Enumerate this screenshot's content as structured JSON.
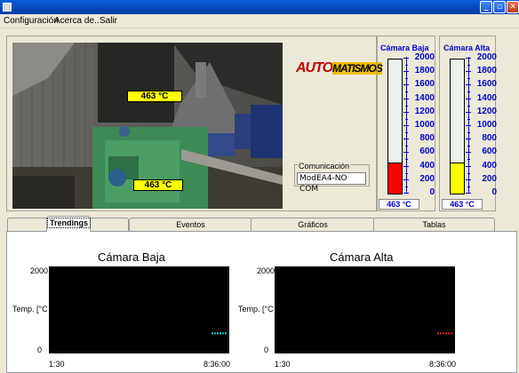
{
  "menu": {
    "items": [
      "Configuración",
      "Acerca de..",
      "Salir"
    ]
  },
  "photo": {
    "label_top": "463 °C",
    "label_bottom": "463 °C"
  },
  "logo": {
    "text_a": "AUTO",
    "text_b": "MATISMOS"
  },
  "comm": {
    "title": "Comunicación",
    "value": "ModEA4-NO COM"
  },
  "gauges": [
    {
      "title": "Cámara Baja",
      "value_text": "463 °C",
      "level": 463,
      "max": 2000,
      "color": "#ff0000",
      "ticks": [
        "2000",
        "1800",
        "1600",
        "1400",
        "1200",
        "1000",
        "800",
        "600",
        "400",
        "200",
        "0"
      ]
    },
    {
      "title": "Cámara Alta",
      "value_text": "463 °C",
      "level": 463,
      "max": 2000,
      "color": "#ffff00",
      "ticks": [
        "2000",
        "1800",
        "1600",
        "1400",
        "1200",
        "1000",
        "800",
        "600",
        "400",
        "200",
        "0"
      ]
    }
  ],
  "tabs": [
    "Trendings",
    "Eventos",
    "Gráficos",
    "Tablas"
  ],
  "active_tab": "Trendings",
  "chart_data": [
    {
      "type": "line",
      "title": "Cámara Baja",
      "ylabel": "Temp. [°C",
      "ylim": [
        0,
        2000
      ],
      "yticks": [
        "2000",
        "0"
      ],
      "xticks": [
        "1:30",
        "8:36:00"
      ],
      "series": [
        {
          "color": "#00d8d8",
          "x": [
            "8:36:00"
          ],
          "values": [
            463
          ]
        }
      ]
    },
    {
      "type": "line",
      "title": "Cámara Alta",
      "ylabel": "Temp. [°C",
      "ylim": [
        0,
        2000
      ],
      "yticks": [
        "2000",
        "0"
      ],
      "xticks": [
        "1:30",
        "8:36:00"
      ],
      "series": [
        {
          "color": "#e02020",
          "x": [
            "8:36:00"
          ],
          "values": [
            463
          ]
        }
      ]
    }
  ]
}
